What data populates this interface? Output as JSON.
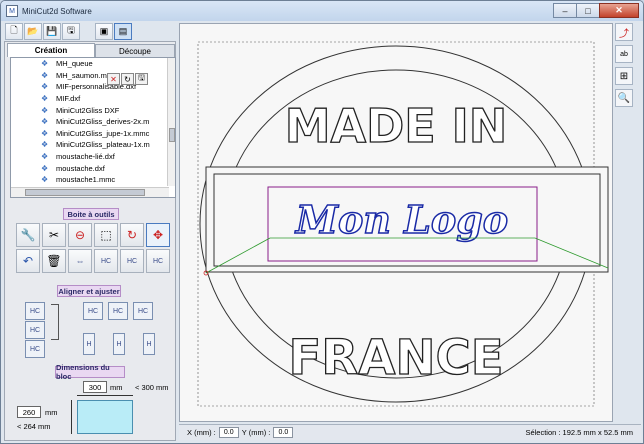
{
  "window": {
    "title": "MiniCut2d Software",
    "app_icon": "minicut-icon",
    "controls": {
      "minimize": "–",
      "maximize": "□",
      "close": "✕"
    }
  },
  "toolbar": {
    "items": [
      {
        "name": "new-file-icon",
        "glyph": "🗋"
      },
      {
        "name": "open-folder-icon",
        "glyph": "📂"
      },
      {
        "name": "save-as-icon",
        "glyph": "💾"
      },
      {
        "name": "save-icon",
        "glyph": "🖫"
      },
      {
        "name": "single-view-icon",
        "glyph": "▣"
      },
      {
        "name": "multi-view-icon",
        "glyph": "▤"
      }
    ]
  },
  "tabs": {
    "creation": "Création",
    "decoupe": "Découpe"
  },
  "file_list": [
    "MH_queue",
    "MH_saumon.mmc",
    "MIF-personnalisable.dxf",
    "MIF.dxf",
    "MiniCut2Gliss DXF",
    "MiniCut2Gliss_derives-2x.m",
    "MiniCut2Gliss_jupe-1x.mmc",
    "MiniCut2Gliss_plateau-1x.m",
    "moustache-lié.dxf",
    "moustache.dxf",
    "moustache1.mmc"
  ],
  "file_tools": {
    "delete": "✕",
    "refresh": "↻",
    "save": "🖫"
  },
  "boite_outils": {
    "label": "Boite à outils",
    "row1": [
      "🔧",
      "✂",
      "⊖",
      "⬚",
      "↻",
      "✥"
    ],
    "row2": [
      "↶",
      "🗑",
      "⇔",
      "HC",
      "HC",
      "HC"
    ]
  },
  "aligner": {
    "label": "Aligner et ajuster"
  },
  "dimensions": {
    "label": "Dimensions du bloc",
    "width_value": "300",
    "width_unit": "mm",
    "width_limit": "< 300 mm",
    "height_value": "260",
    "height_unit": "mm",
    "height_limit": "< 264 mm"
  },
  "canvas": {
    "top_text": "MADE IN",
    "bottom_text": "FRANCE",
    "logo_text": "Mon Logo"
  },
  "right_tools": [
    {
      "name": "curve-tool-icon",
      "glyph": "⤴"
    },
    {
      "name": "text-tool-icon",
      "glyph": "ab"
    },
    {
      "name": "export-icon",
      "glyph": "⊞"
    },
    {
      "name": "zoom-icon",
      "glyph": "🔍"
    }
  ],
  "status": {
    "x_label": "X (mm) :",
    "x_value": "0.0",
    "y_label": "Y (mm) :",
    "y_value": "0.0",
    "selection": "Sélection : 192.5 mm x 52.5 mm"
  },
  "colors": {
    "accent": "#b58dc7",
    "logo": "#1a2aa6",
    "selection": "#7a1e7a",
    "guide": "#2e9a2e"
  }
}
